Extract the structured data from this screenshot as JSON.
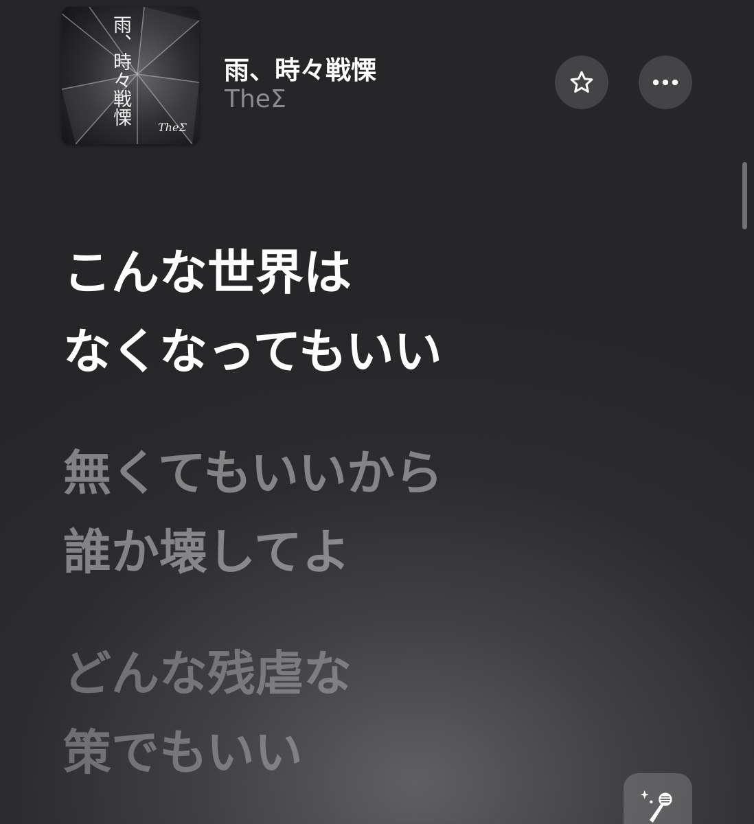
{
  "now_playing": {
    "artwork": {
      "title_text": "雨、時々戦慄",
      "logo_text": "TheΣ"
    },
    "title": "雨、時々戦慄",
    "artist": "TheΣ"
  },
  "actions": {
    "favorite_icon": "star-outline-icon",
    "more_icon": "ellipsis-icon",
    "sing_icon": "microphone-sparkles-icon"
  },
  "lyrics": {
    "blocks": [
      {
        "lines": [
          "こんな世界は",
          "なくなってもいい"
        ]
      },
      {
        "lines": [
          "無くてもいいから",
          "誰か壊してよ"
        ]
      },
      {
        "lines": [
          "どんな残虐な",
          "策でもいい"
        ]
      }
    ]
  },
  "colors": {
    "background": "#2c2c30",
    "active_lyric": "#ffffff",
    "inactive_lyric": "#8a8a8e",
    "artist": "#8c8c90"
  }
}
